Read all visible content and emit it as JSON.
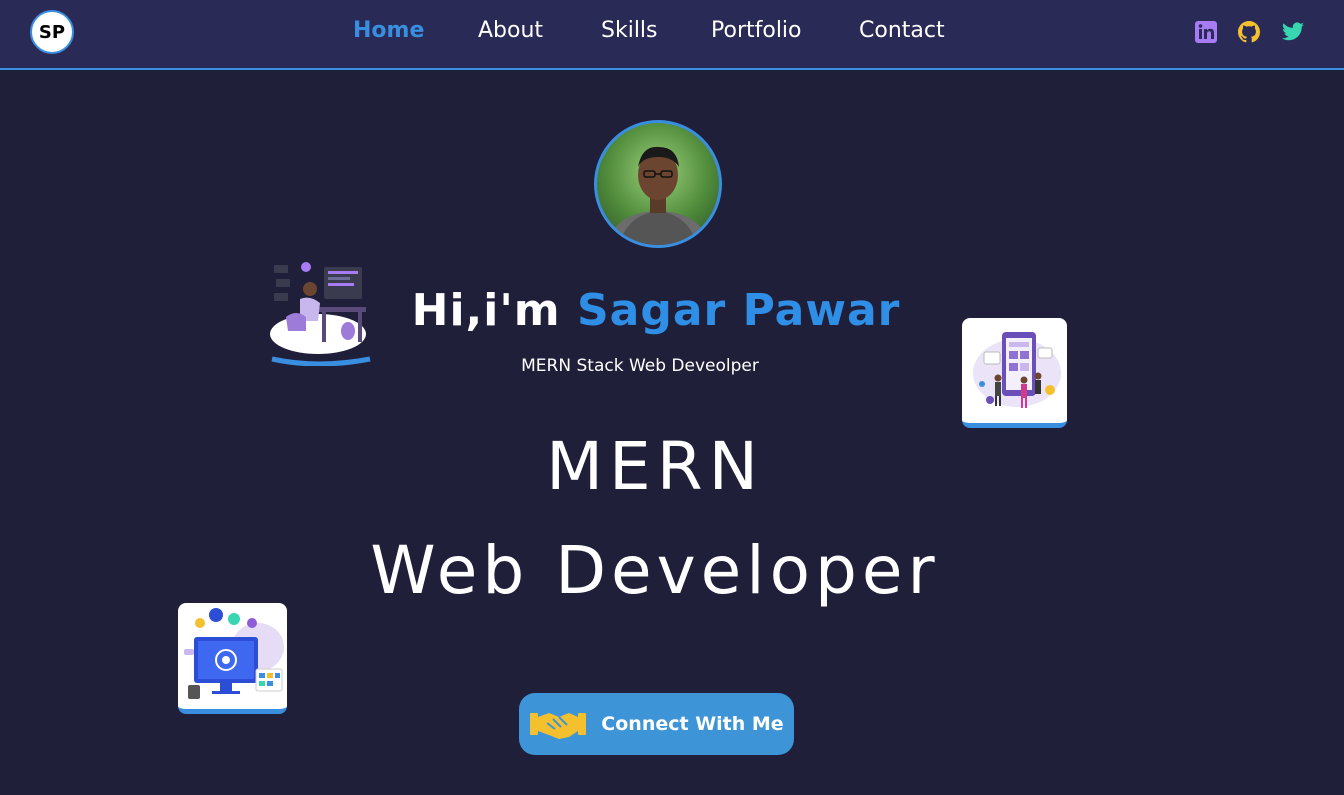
{
  "logo": {
    "text": "SP"
  },
  "nav": {
    "items": [
      {
        "label": "Home",
        "active": true
      },
      {
        "label": "About",
        "active": false
      },
      {
        "label": "Skills",
        "active": false
      },
      {
        "label": "Portfolio",
        "active": false
      },
      {
        "label": "Contact",
        "active": false
      }
    ]
  },
  "social": [
    {
      "icon": "linkedin-icon",
      "color": "#a77bf3"
    },
    {
      "icon": "github-icon",
      "color": "#f5c02d"
    },
    {
      "icon": "twitter-icon",
      "color": "#37d6b0"
    }
  ],
  "hero": {
    "greeting_prefix": "Hi,i'm",
    "name": "Sagar Pawar",
    "subtitle": "MERN Stack Web Deveolper",
    "headline_line1": "MERN",
    "headline_line2": "Web Developer",
    "cta_label": "Connect With Me",
    "cta_icon": "handshake-icon"
  },
  "colors": {
    "background": "#1f1f3a",
    "navbar": "#2a2a56",
    "accent": "#3a8ee0",
    "name": "#2f8fe6"
  }
}
